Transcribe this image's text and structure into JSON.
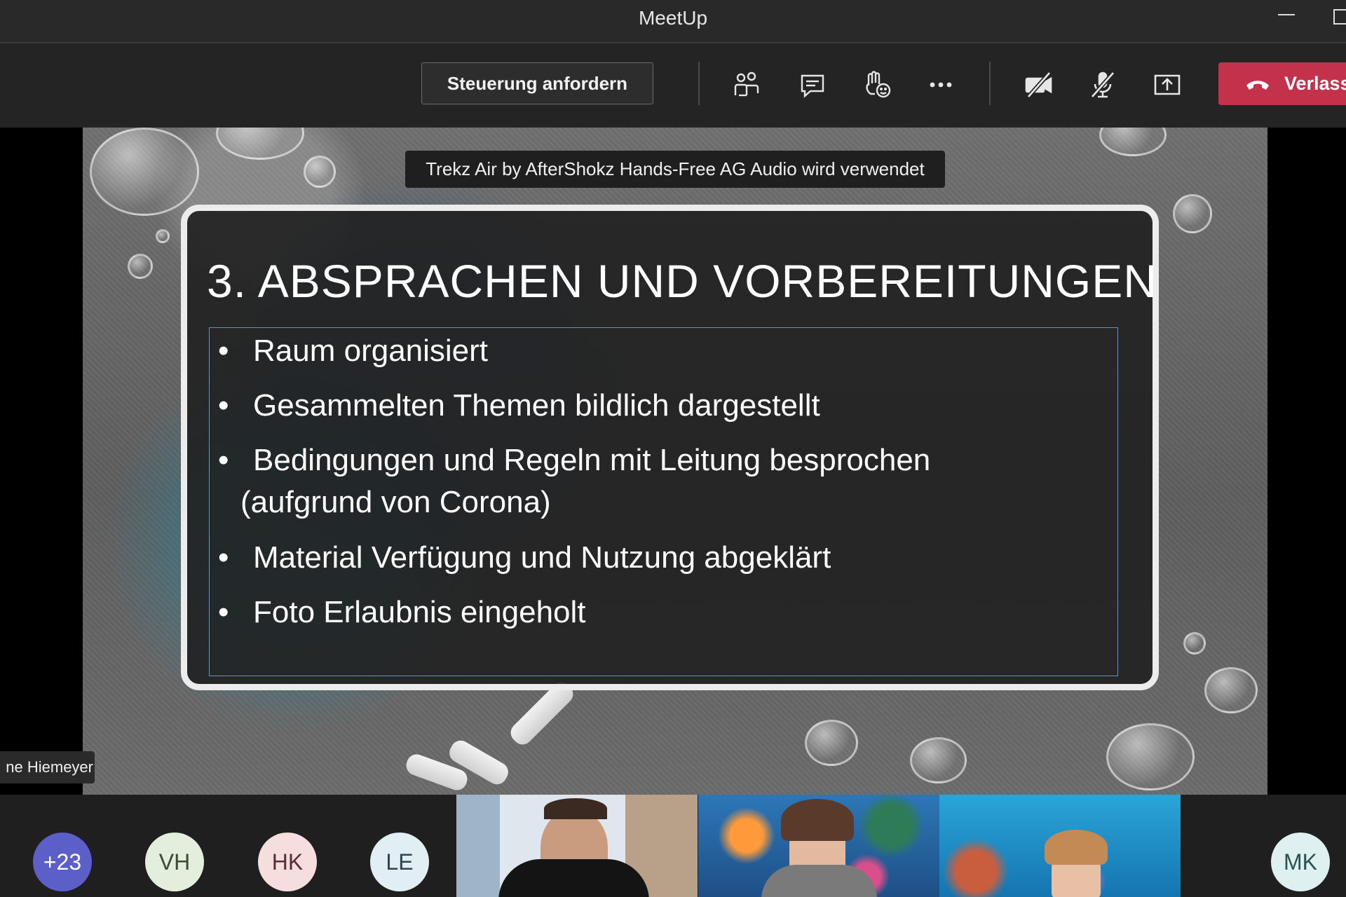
{
  "window": {
    "title": "MeetUp"
  },
  "toolbar": {
    "request_control_label": "Steuerung anfordern",
    "icons": [
      "people-icon",
      "chat-icon",
      "raise-hand-icon",
      "more-icon",
      "camera-off-icon",
      "mic-off-icon",
      "share-icon"
    ],
    "leave_label": "Verlass",
    "leave_color": "#c4314b"
  },
  "stage": {
    "device_banner": "Trekz Air by AfterShokz Hands-Free AG Audio wird verwendet",
    "presenter_name": "ne Hiemeyer",
    "slide": {
      "title": "3. ABSPRACHEN UND VORBEREITUNGEN",
      "bullets": [
        {
          "text": "Raum organisiert"
        },
        {
          "text": "Gesammelten Themen bildlich dargestellt"
        },
        {
          "text": "Bedingungen und Regeln mit Leitung besprochen",
          "continuation": "(aufgrund von Corona)"
        },
        {
          "text": "Material Verfügung und Nutzung abgeklärt"
        },
        {
          "text": "Foto Erlaubnis eingeholt"
        }
      ]
    }
  },
  "gallery": {
    "avatars": [
      {
        "initials": "+23",
        "bg": "#5b5fc7",
        "fg": "#ffffff"
      },
      {
        "initials": "VH",
        "bg": "#e4eedc",
        "fg": "#3b4a33"
      },
      {
        "initials": "HK",
        "bg": "#f6dede",
        "fg": "#5b2f2f"
      },
      {
        "initials": "LE",
        "bg": "#e1eef4",
        "fg": "#2d4654"
      },
      {
        "initials": "MK",
        "bg": "#dff0f0",
        "fg": "#2e5050"
      }
    ]
  }
}
